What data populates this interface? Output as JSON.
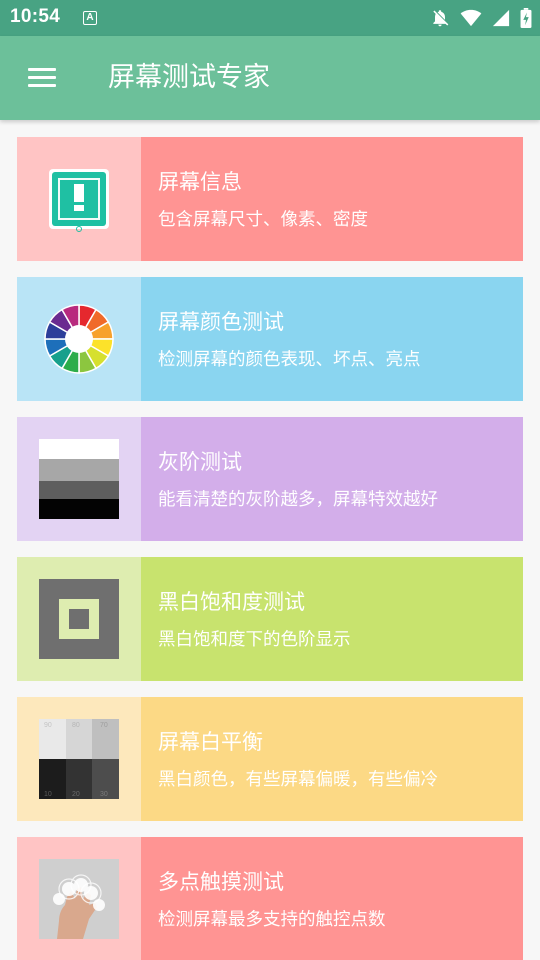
{
  "status_bar": {
    "time": "10:54",
    "notification_icon_letter": "A",
    "icons": [
      "notifications-off-icon",
      "wifi-icon",
      "signal-icon",
      "battery-charging-icon"
    ]
  },
  "app_bar": {
    "title": "屏幕测试专家",
    "menu_icon": "menu-icon"
  },
  "colors": {
    "status_bar": "#48a383",
    "app_bar": "#6cc09a"
  },
  "cards": [
    {
      "title": "屏幕信息",
      "description": "包含屏幕尺寸、像素、密度",
      "thumb_color": "#ffc4c4",
      "body_color": "#ff9493",
      "icon": "screen-info-icon"
    },
    {
      "title": "屏幕颜色测试",
      "description": "检测屏幕的颜色表现、坏点、亮点",
      "thumb_color": "#b9e4f6",
      "body_color": "#8ad5f0",
      "icon": "color-wheel-icon"
    },
    {
      "title": "灰阶测试",
      "description": "能看清楚的灰阶越多，屏幕特效越好",
      "thumb_color": "#e3d3f3",
      "body_color": "#d3aeea",
      "icon": "grayscale-icon"
    },
    {
      "title": "黑白饱和度测试",
      "description": "黑白饱和度下的色阶显示",
      "thumb_color": "#deedb0",
      "body_color": "#c8e36e",
      "icon": "saturation-icon"
    },
    {
      "title": "屏幕白平衡",
      "description": "黑白颜色，有些屏幕偏暖，有些偏冷",
      "thumb_color": "#fde8bc",
      "body_color": "#fcd985",
      "icon": "white-balance-icon",
      "swatch_labels": [
        "90",
        "80",
        "70",
        "10",
        "20",
        "30"
      ]
    },
    {
      "title": "多点触摸测试",
      "description": "检测屏幕最多支持的触控点数",
      "thumb_color": "#ffc4c4",
      "body_color": "#ff9493",
      "icon": "multitouch-hand-icon"
    }
  ]
}
